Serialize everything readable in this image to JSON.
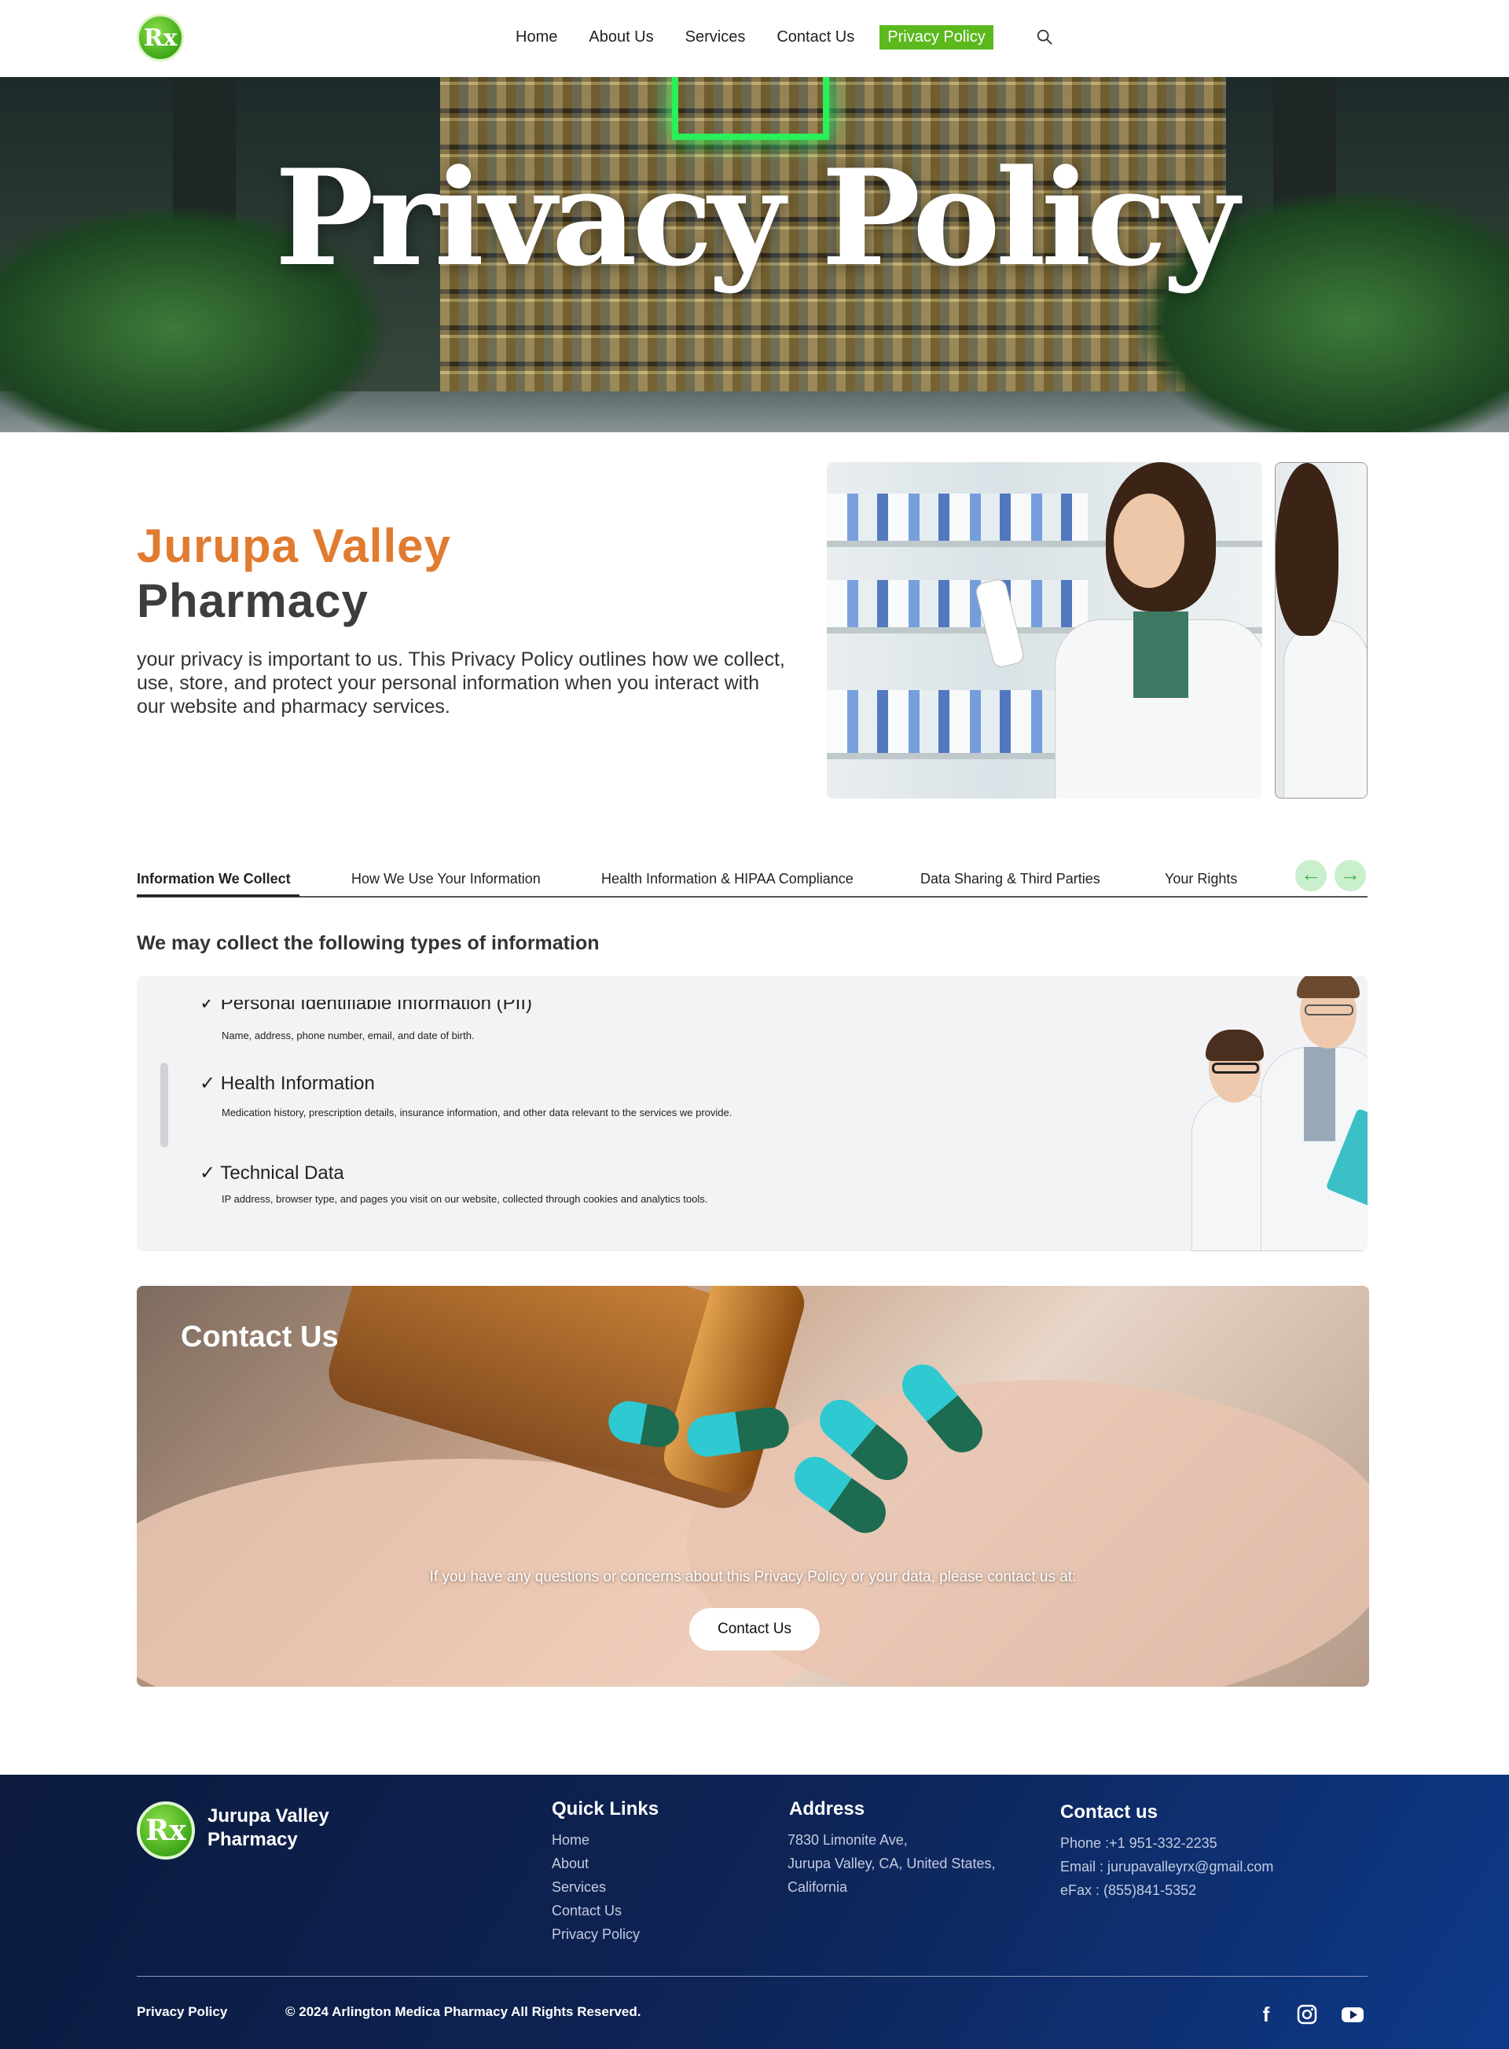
{
  "nav": {
    "links": [
      "Home",
      "About Us",
      "Services",
      "Contact Us",
      "Privacy Policy"
    ],
    "active_index": 4,
    "accent_color": "#5bb91d"
  },
  "hero": {
    "title": "Privacy Policy"
  },
  "intro": {
    "title_line1": "Jurupa Valley",
    "title_line2": "Pharmacy",
    "text": "your privacy is important to us. This Privacy Policy outlines how we collect, use, store, and protect your personal information when you interact with our website and pharmacy services.",
    "accent_color": "#e07b30"
  },
  "tabs": {
    "items": [
      "Information We Collect",
      "How We Use Your Information",
      "Health Information & HIPAA Compliance",
      "Data Sharing & Third Parties",
      "Your Rights"
    ],
    "active_index": 0,
    "prev_icon": "arrow-left-icon",
    "next_icon": "arrow-right-icon"
  },
  "info": {
    "heading": "We may collect the following types of information",
    "items": [
      {
        "title": "✓ Personal Identifiable Information (PII)",
        "desc": "Name, address, phone number, email, and date of birth."
      },
      {
        "title": "✓ Health Information",
        "desc": "Medication history, prescription details, insurance information, and other data relevant to the services we provide."
      },
      {
        "title": "✓ Technical Data",
        "desc": "IP address, browser type, and pages you visit on our website, collected through cookies and analytics tools."
      }
    ]
  },
  "contact": {
    "title": "Contact Us",
    "text": "If you have any questions or concerns about this Privacy Policy or your data, please contact us at:",
    "button": "Contact Us"
  },
  "footer": {
    "brand": "Jurupa Valley Pharmacy",
    "quick_links_title": "Quick Links",
    "quick_links": [
      "Home",
      "About",
      "Services",
      "Contact Us",
      "Privacy Policy"
    ],
    "address_title": "Address",
    "address_lines": [
      "7830 Limonite Ave,",
      "Jurupa Valley, CA, United States,",
      "California"
    ],
    "contact_title": "Contact us",
    "contact_lines": [
      "Phone :+1 951-332-2235",
      "Email : jurupavalleyrx@gmail.com",
      "eFax : (855)841-5352"
    ],
    "bottom_link": "Privacy Policy",
    "copyright": "© 2024 Arlington Medica Pharmacy All Rights Reserved.",
    "social_icons": [
      "facebook-icon",
      "instagram-icon",
      "youtube-icon"
    ],
    "logo_text": "Rx"
  }
}
